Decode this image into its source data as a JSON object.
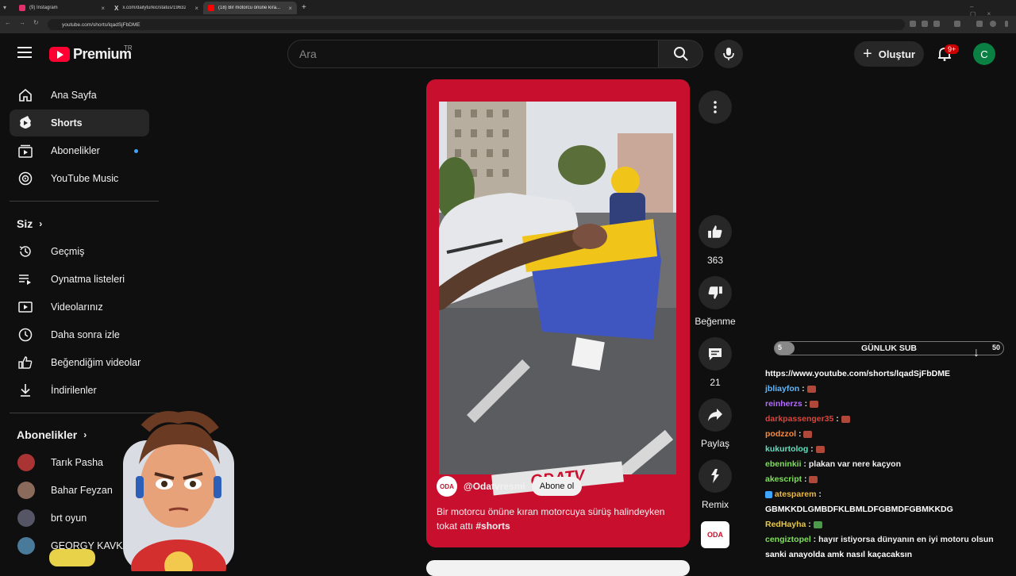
{
  "browser": {
    "tabs": [
      {
        "title": "(9) Instagram",
        "color": "#e1306c"
      },
      {
        "title": "x.com/dailyturkic/status/19632...",
        "color": "#ffffff"
      },
      {
        "title": "(18) Bir motorcu önüne kıra...",
        "color": "#ff0000"
      }
    ],
    "url": "youtube.com/shorts/lqadSjFbDME"
  },
  "header": {
    "logo_text": "Premium",
    "logo_region": "TR",
    "search_placeholder": "Ara",
    "create_label": "Oluştur",
    "notification_count": "9+",
    "avatar_letter": "C"
  },
  "sidebar": {
    "main": [
      {
        "label": "Ana Sayfa",
        "icon": "home-icon"
      },
      {
        "label": "Shorts",
        "icon": "shorts-icon"
      },
      {
        "label": "Abonelikler",
        "icon": "subscriptions-icon"
      },
      {
        "label": "YouTube Music",
        "icon": "music-icon"
      }
    ],
    "you_title": "Siz",
    "you": [
      {
        "label": "Geçmiş",
        "icon": "history-icon"
      },
      {
        "label": "Oynatma listeleri",
        "icon": "playlist-icon"
      },
      {
        "label": "Videolarınız",
        "icon": "your-videos-icon"
      },
      {
        "label": "Daha sonra izle",
        "icon": "clock-icon"
      },
      {
        "label": "Beğendiğim videolar",
        "icon": "like-icon"
      },
      {
        "label": "İndirilenler",
        "icon": "download-icon"
      }
    ],
    "subs_title": "Abonelikler",
    "subs": [
      {
        "name": "Tarık Pasha",
        "color": "#a33"
      },
      {
        "name": "Bahar Feyzan",
        "color": "#8a6a5a"
      },
      {
        "name": "brt oyun",
        "color": "#556"
      },
      {
        "name": "GEORGY KAVKA...",
        "color": "#4a7a9a"
      }
    ]
  },
  "short": {
    "channel_handle": "@Odatvresmi",
    "subscribe_label": "Abone ol",
    "title": "Bir motorcu önüne kıran motorcuya sürüş halindeyken tokat attı",
    "hashtag": "#shorts",
    "watermark": "ODATV",
    "channel_logo_text": "ODA"
  },
  "actions": {
    "likes": "363",
    "dislike_label": "Beğenme",
    "comments": "21",
    "share_label": "Paylaş",
    "remix_label": "Remix"
  },
  "stream_overlay": {
    "goal_title": "GÜNLUK SUB",
    "goal_current": "5",
    "goal_target": "50",
    "chat": [
      {
        "user": "",
        "text": "https://www.youtube.com/shorts/lqadSjFbDME",
        "color": "#ffffff"
      },
      {
        "user": "jbliayfon",
        "text": "",
        "color": "#5fb8ff",
        "emote": "brick"
      },
      {
        "user": "reinherzs",
        "text": "",
        "color": "#b36bff",
        "emote": "brick"
      },
      {
        "user": "darkpassenger35",
        "text": "",
        "color": "#e0433a",
        "emote": "brick"
      },
      {
        "user": "podzzol",
        "text": "",
        "color": "#ff8a3a",
        "emote": "brick"
      },
      {
        "user": "kukurtolog",
        "text": "",
        "color": "#5fe0c0",
        "emote": "brick"
      },
      {
        "user": "ebeninkii",
        "text": "plakan var nere kaçyon",
        "color": "#7ee05a"
      },
      {
        "user": "akescript",
        "text": "",
        "color": "#7ee05a",
        "emote": "brick"
      },
      {
        "user": "atesparem",
        "text": "",
        "color": "#e8b84a"
      },
      {
        "user": "",
        "text": "GBMKKDLGMBDFKLBMLDFGBMDFGBMKKDG",
        "color": "#ffffff"
      },
      {
        "user": "RedHayha",
        "text": "",
        "color": "#e8c84a",
        "emote": "money"
      },
      {
        "user": "cengiztopel",
        "text": "hayır istiyorsa dünyanın en iyi motoru olsun",
        "color": "#7ee05a"
      },
      {
        "user": "",
        "text": "sanki anayolda amk nasıl kaçacaksın",
        "color": "#ffffff"
      }
    ]
  }
}
